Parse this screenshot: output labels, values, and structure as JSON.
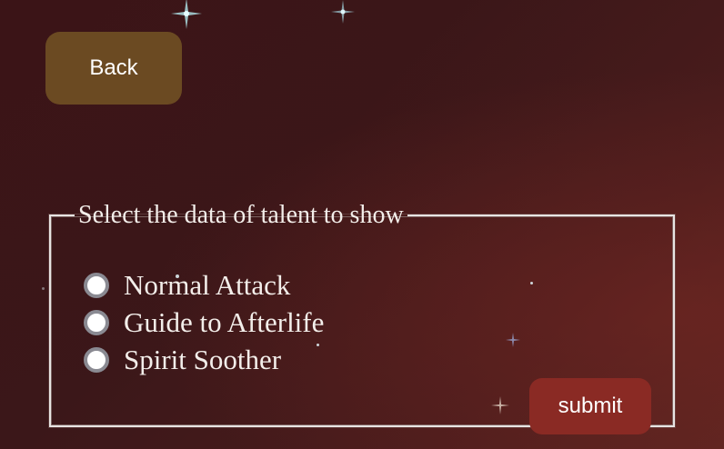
{
  "back_button": {
    "label": "Back"
  },
  "talent_form": {
    "legend": "Select the data of talent to show",
    "options": [
      {
        "label": "Normal Attack"
      },
      {
        "label": "Guide to Afterlife"
      },
      {
        "label": "Spirit Soother"
      }
    ],
    "submit_label": "submit"
  },
  "colors": {
    "back_button_bg": "#6b4a22",
    "submit_button_bg": "#8a2a24",
    "background": "#3b1719"
  }
}
